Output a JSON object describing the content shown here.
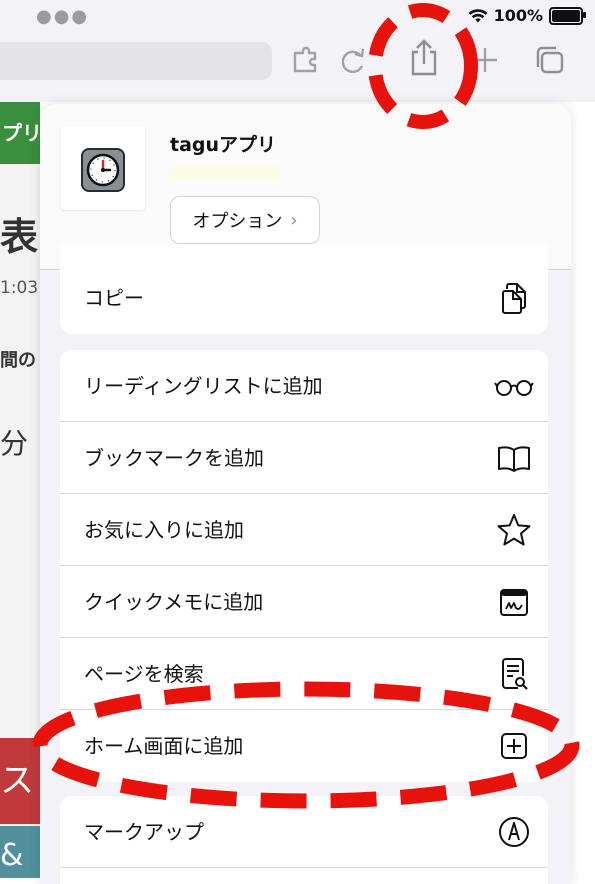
{
  "status": {
    "battery_pct": "100%",
    "battery_level": 1.0
  },
  "app": {
    "title": "taguアプリ",
    "options_label": "オプション"
  },
  "background_page": {
    "banner_text": "プリ",
    "fragments": [
      "表",
      "1:03",
      "間の",
      "分"
    ],
    "red_tile": "スト",
    "teal_tile": "&"
  },
  "actions": {
    "copy": "コピー",
    "reading_list": "リーディングリストに追加",
    "bookmark": "ブックマークを追加",
    "favorites": "お気に入りに追加",
    "quick_note": "クイックメモに追加",
    "find": "ページを検索",
    "home_screen": "ホーム画面に追加",
    "markup": "マークアップ"
  },
  "colors": {
    "annotation_red": "#e8120c",
    "header_green": "#3a8f3e",
    "sheet_bg": "#f2f2f7"
  },
  "icons": [
    "wifi-icon",
    "battery-icon",
    "extension-icon",
    "reload-icon",
    "share-icon",
    "add-tab-icon",
    "tabs-icon",
    "clock-app-icon",
    "chevron-right-icon",
    "copy-icon",
    "glasses-icon",
    "book-icon",
    "star-icon",
    "quick-note-icon",
    "find-icon",
    "add-square-icon",
    "markup-icon"
  ]
}
